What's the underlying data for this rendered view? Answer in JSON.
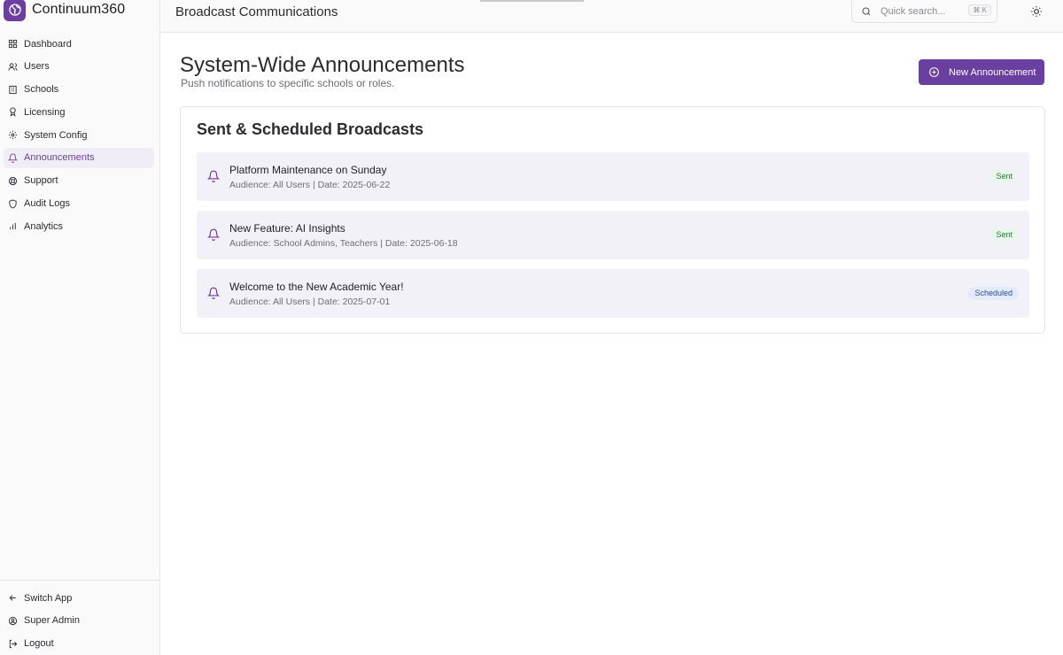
{
  "app": {
    "name": "Continuum360"
  },
  "nav": {
    "items": [
      {
        "label": "Dashboard",
        "icon": "grid-icon"
      },
      {
        "label": "Users",
        "icon": "users-icon"
      },
      {
        "label": "Schools",
        "icon": "building-icon"
      },
      {
        "label": "Licensing",
        "icon": "award-icon"
      },
      {
        "label": "System Config",
        "icon": "gear-icon"
      },
      {
        "label": "Announcements",
        "icon": "bell-icon",
        "active": true
      },
      {
        "label": "Support",
        "icon": "lifebuoy-icon"
      },
      {
        "label": "Audit Logs",
        "icon": "shield-icon"
      },
      {
        "label": "Analytics",
        "icon": "bar-chart-icon"
      }
    ],
    "bottom": [
      {
        "label": "Switch App",
        "icon": "arrow-left-icon"
      },
      {
        "label": "Super Admin",
        "icon": "user-circle-icon"
      },
      {
        "label": "Logout",
        "icon": "logout-icon"
      }
    ]
  },
  "topbar": {
    "title": "Broadcast Communications",
    "search_placeholder": "Quick search...",
    "shortcut": "⌘ K"
  },
  "page": {
    "title": "System-Wide Announcements",
    "subtitle": "Push notifications to specific schools or roles.",
    "new_button": "New Announcement"
  },
  "broadcasts": {
    "title": "Sent & Scheduled Broadcasts",
    "items": [
      {
        "title": "Platform Maintenance on Sunday",
        "meta": "Audience: All Users | Date: 2025-06-22",
        "status": "Sent"
      },
      {
        "title": "New Feature: AI Insights",
        "meta": "Audience: School Admins, Teachers | Date: 2025-06-18",
        "status": "Sent"
      },
      {
        "title": "Welcome to the New Academic Year!",
        "meta": "Audience: All Users | Date: 2025-07-01",
        "status": "Scheduled"
      }
    ]
  },
  "colors": {
    "accent": "#6b3fa0",
    "sent": "#1f7a3a",
    "scheduled": "#2a4f9c"
  }
}
